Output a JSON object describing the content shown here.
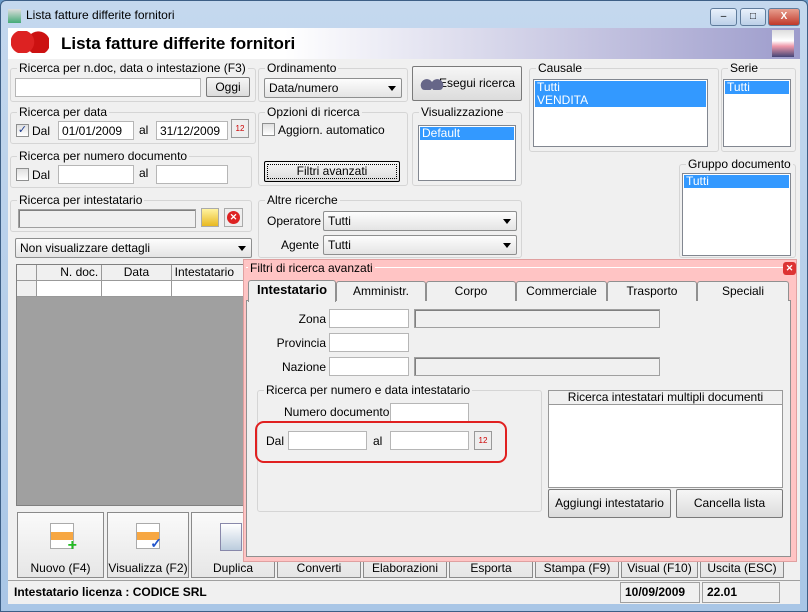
{
  "window": {
    "title": "Lista fatture differite fornitori",
    "banner_title": "Lista fatture differite fornitori",
    "minimize": "–",
    "maximize": "□",
    "close": "X"
  },
  "search_general": {
    "legend": "Ricerca per n.doc, data o intestazione (F3)",
    "value": "",
    "today_button": "Oggi"
  },
  "search_date": {
    "legend": "Ricerca per data",
    "checked": true,
    "from_label": "Dal",
    "from": "01/01/2009",
    "to_label": "al",
    "to": "31/12/2009"
  },
  "search_number": {
    "legend": "Ricerca per numero documento",
    "checked": false,
    "from_label": "Dal",
    "from": "",
    "to_label": "al",
    "to": ""
  },
  "search_holder": {
    "legend": "Ricerca per intestatario",
    "value": ""
  },
  "details_select": "Non visualizzare dettagli",
  "grid": {
    "columns": [
      "",
      "N. doc.",
      "Data",
      "Intestatario"
    ]
  },
  "sorting": {
    "legend": "Ordinamento",
    "value": "Data/numero"
  },
  "run_search": "Esegui ricerca",
  "options": {
    "legend": "Opzioni di ricerca",
    "auto_update": "Aggiorn. automatico",
    "auto_checked": false,
    "advanced_button": "Filtri avanzati"
  },
  "view": {
    "legend": "Visualizzazione",
    "items": [
      "Default"
    ]
  },
  "other": {
    "legend": "Altre ricerche",
    "operator_label": "Operatore :",
    "operator": "Tutti",
    "agent_label": "Agente :",
    "agent": "Tutti"
  },
  "causale": {
    "legend": "Causale",
    "items": [
      "Tutti",
      "VENDITA"
    ]
  },
  "serie": {
    "legend": "Serie",
    "items": [
      "Tutti"
    ]
  },
  "gruppo": {
    "legend": "Gruppo documento",
    "items": [
      "Tutti"
    ]
  },
  "toolbar": [
    "Nuovo (F4)",
    "Visualizza (F2)",
    "Duplica",
    "Converti",
    "Elaborazioni",
    "Esporta",
    "Stampa (F9)",
    "Visual (F10)",
    "Uscita (ESC)"
  ],
  "status": {
    "license": "Intestatario licenza : CODICE SRL",
    "date": "10/09/2009",
    "time": "22.01"
  },
  "advanced": {
    "title": "Filtri di ricerca avanzati",
    "tabs": [
      "Intestatario",
      "Amministr.",
      "Corpo",
      "Commerciale",
      "Trasporto",
      "Speciali"
    ],
    "active_tab": "Intestatario",
    "zona_label": "Zona",
    "provincia_label": "Provincia",
    "nazione_label": "Nazione",
    "group_legend": "Ricerca per numero e data intestatario",
    "doc_number_label": "Numero documento :",
    "from_label": "Dal",
    "to_label": "al",
    "multi_header": "Ricerca intestatari multipli documenti",
    "add_button": "Aggiungi intestatario",
    "clear_button": "Cancella lista",
    "highlight_color": "#e02020"
  }
}
